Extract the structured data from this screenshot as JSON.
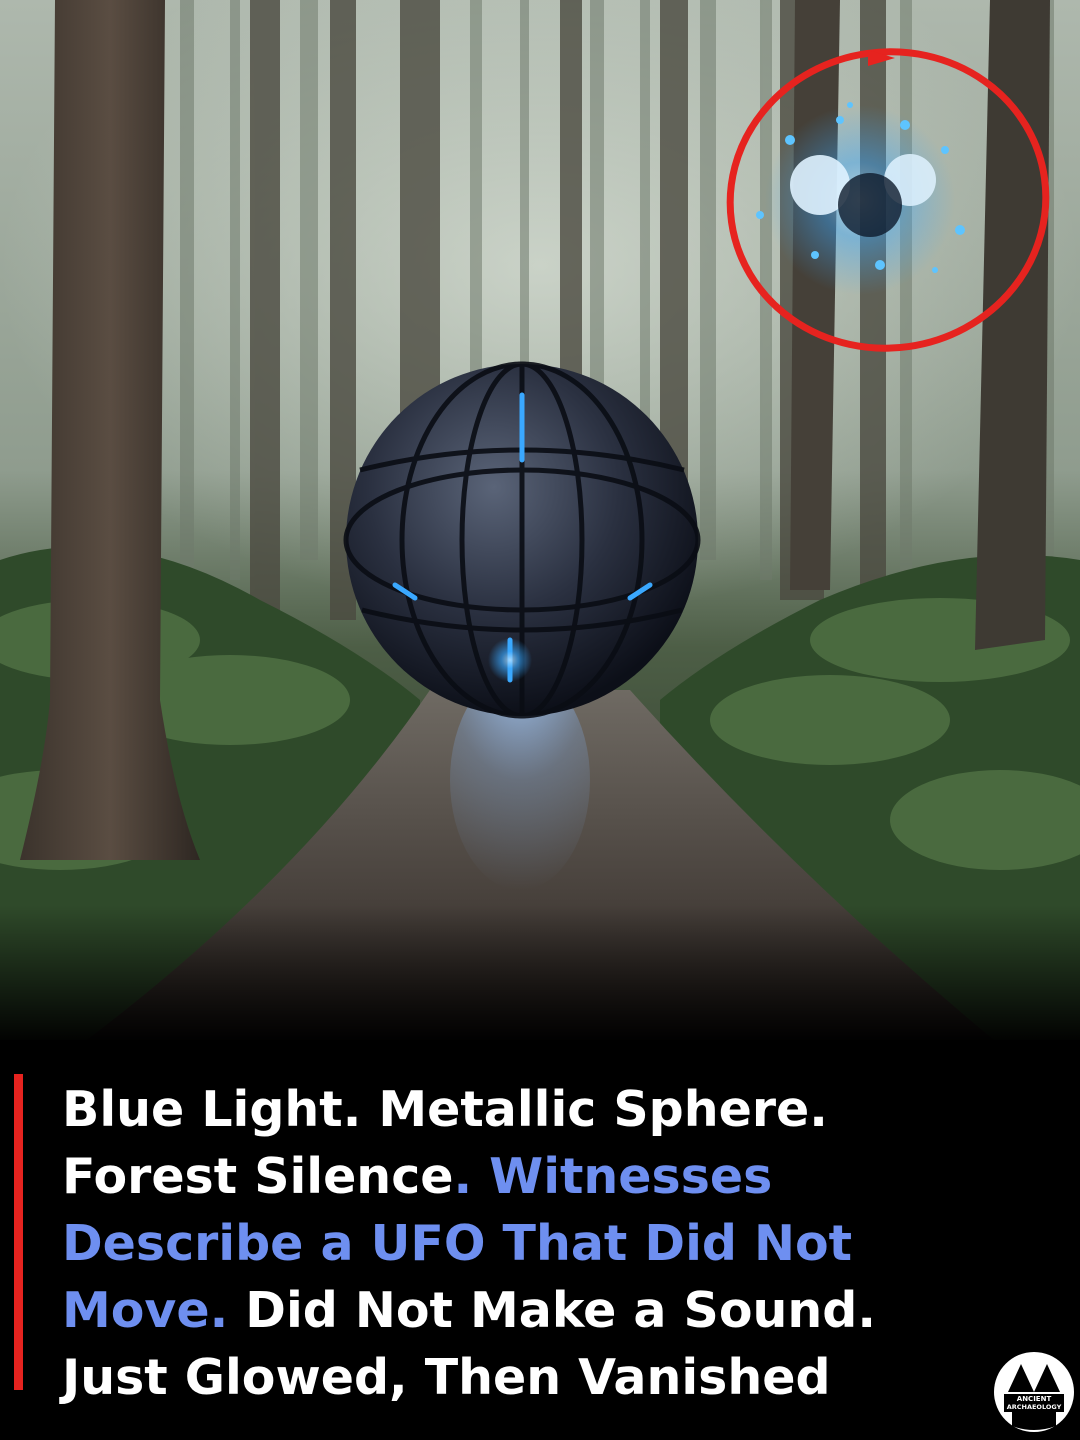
{
  "headline": {
    "line1": "Blue Light. Metallic Sphere.",
    "line2_white": "Forest Silence",
    "line2_blue": ". Witnesses",
    "line3_blue": "Describe a UFO That Did Not",
    "line4_blue": "Move.",
    "line4_white": " Did Not Make a Sound.",
    "line5": "Just Glowed, Then Vanished"
  },
  "logo": {
    "line1": "ANCIENT",
    "line2": "ARCHAEOLOGY",
    "icon": "aa-logo-icon"
  },
  "colors": {
    "caption_background": "#000000",
    "accent_red": "#e6231f",
    "highlight_blue": "#6e8ff0",
    "glow_blue": "#3aa8ff"
  }
}
